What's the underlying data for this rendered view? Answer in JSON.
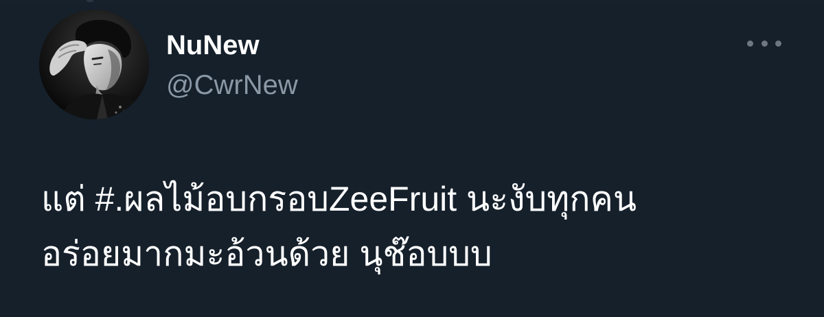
{
  "tweet": {
    "author": {
      "name": "NuNew",
      "handle": "@CwrNew"
    },
    "text": {
      "line1_before": "แต่ ",
      "hashtag": "#.ผลไม้อบกรอบZeeFruit",
      "line1_after": " นะงับทุกคน",
      "line2": "อร่อยมากมะอ้วนด้วย นุช๊อบบบ"
    },
    "more_menu_icon": "more-horizontal-icon"
  },
  "colors": {
    "background": "#15202b",
    "name": "#ffffff",
    "handle": "#8b98a5",
    "text": "#ffffff",
    "more_dots": "#6e7781"
  }
}
